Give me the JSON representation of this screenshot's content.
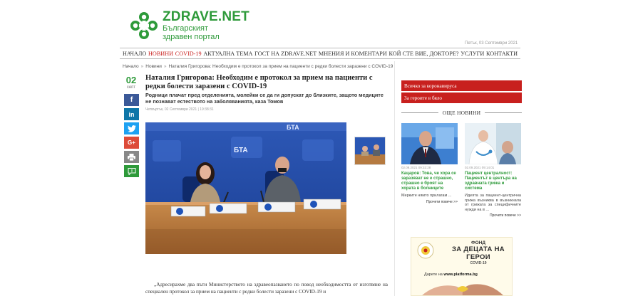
{
  "header": {
    "logo_name": "ZDRAVE.NET",
    "logo_tagline_1": "Българският",
    "logo_tagline_2": "здравен портал",
    "date": "Петък, 03 Септември 2021"
  },
  "nav": [
    {
      "label": "НАЧАЛО",
      "active": false
    },
    {
      "label": "НОВИНИ",
      "active": true
    },
    {
      "label": "COVID-19",
      "active": true
    },
    {
      "label": "АКТУАЛНА ТЕМА",
      "active": false
    },
    {
      "label": "ГОСТ НА ZDRAVE.NET",
      "active": false
    },
    {
      "label": "МНЕНИЯ И КОМЕНТАРИ",
      "active": false
    },
    {
      "label": "КОЙ СТЕ ВИЕ, ДОКТОРЕ?",
      "active": false
    },
    {
      "label": "УСЛУГИ",
      "active": false
    },
    {
      "label": "КОНТАКТИ",
      "active": false
    }
  ],
  "breadcrumb": {
    "home": "Начало",
    "section": "Новини",
    "current": "Наталия Григорова: Необходим е протокол за прием на пациенти с редки болести заразени с COVID-19"
  },
  "date_box": {
    "day": "02",
    "month": "септ"
  },
  "share": [
    {
      "icon": "facebook-icon",
      "glyph": "f",
      "color": "#3b5998"
    },
    {
      "icon": "linkedin-icon",
      "glyph": "in",
      "color": "#0e76a8"
    },
    {
      "icon": "twitter-icon",
      "glyph": "t",
      "color": "#1da1f2"
    },
    {
      "icon": "google-plus-icon",
      "glyph": "G+",
      "color": "#dd4b39"
    },
    {
      "icon": "print-icon",
      "glyph": "",
      "color": "#888888"
    },
    {
      "icon": "comment-icon",
      "glyph": "",
      "color": "#2e9a3a"
    }
  ],
  "article": {
    "title": "Наталия Григорова: Необходим е протокол за прием на пациенти с редки болести заразени с COVID-19",
    "lead": "Родници плачат пред отделенията, молейки се да ги допускат до близките, защото медиците не познават естеството на заболяванията, каза Томов",
    "meta": "Четвъртък, 02 Септември 2021 | 19:38:31",
    "body": "„Адресирахме два пъти Министерството на здравеопазването по повод необходимостта от изготвяне на специален протокол за прием на пациенти с редки болести заразени с COVID-19 и"
  },
  "sidebar": {
    "buttons": [
      "Всичко за коронавируса",
      "За героите в бяло"
    ],
    "more_news_label": "ОЩЕ НОВИНИ",
    "news": [
      {
        "date": "02.09.2021 09:32:28",
        "title": "Кацаров: Това, че хора се заразяват не е страшно, страшно е броят на хората в болниците",
        "excerpt": "Мерките нямто прилагам ...",
        "more": "Прочети повече >>"
      },
      {
        "date": "02.09.2021 09:14:01",
        "title": "Пациент централност: Пациентът в центъра на здравната грижа и система",
        "excerpt": "Идеята за пациент-центрична грижа възниква в възникнала от грижата за специфичните нужди на в ...",
        "more": "Прочети повече >>"
      }
    ],
    "ad": {
      "line1": "ФОНД",
      "line2": "ЗА ДЕЦАТА НА ГЕРОИ",
      "line3": "COVID-19",
      "donate_prefix": "Дарете на ",
      "donate_site": "www.platforma.bg"
    }
  },
  "colors": {
    "brand_green": "#2e9a3a",
    "accent_red": "#c8201e"
  }
}
